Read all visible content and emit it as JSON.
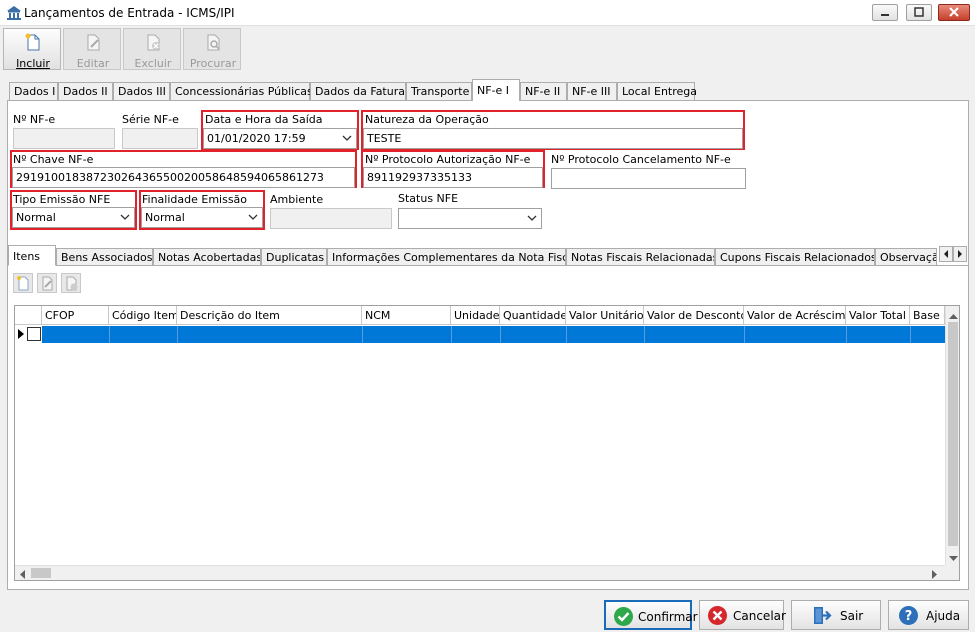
{
  "window": {
    "title": "Lançamentos de Entrada - ICMS/IPI",
    "icon": "bank-icon"
  },
  "toolbar": {
    "incluir": "Incluir",
    "editar": "Editar",
    "excluir": "Excluir",
    "procurar": "Procurar"
  },
  "main_tabs": [
    {
      "label": "Dados I"
    },
    {
      "label": "Dados II"
    },
    {
      "label": "Dados III"
    },
    {
      "label": "Concessionárias Públicas"
    },
    {
      "label": "Dados da Fatura"
    },
    {
      "label": "Transporte"
    },
    {
      "label": "NF-e I",
      "active": true
    },
    {
      "label": "NF-e II"
    },
    {
      "label": "NF-e III"
    },
    {
      "label": "Local Entrega"
    }
  ],
  "form": {
    "nf_numero": {
      "label": "Nº NF-e",
      "value": ""
    },
    "serie": {
      "label": "Série NF-e",
      "value": ""
    },
    "data_hora_saida": {
      "label": "Data e Hora da Saída",
      "value": "01/01/2020 17:59"
    },
    "natureza_operacao": {
      "label": "Natureza da Operação",
      "value": "TESTE"
    },
    "chave_nfe": {
      "label": "Nº Chave NF-e",
      "value": "29191001838723026436550020058648594065861273"
    },
    "protocolo_autorizacao": {
      "label": "Nº Protocolo Autorização NF-e",
      "value": "891192937335133"
    },
    "protocolo_cancelamento": {
      "label": "Nº Protocolo Cancelamento NF-e",
      "value": ""
    },
    "tipo_emissao": {
      "label": "Tipo Emissão NFE",
      "value": "Normal"
    },
    "finalidade_emissao": {
      "label": "Finalidade Emissão",
      "value": "Normal"
    },
    "ambiente": {
      "label": "Ambiente",
      "value": ""
    },
    "status_nfe": {
      "label": "Status NFE",
      "value": ""
    }
  },
  "inner_tabs": [
    {
      "label": "Itens",
      "active": true
    },
    {
      "label": "Bens Associados"
    },
    {
      "label": "Notas Acobertadas"
    },
    {
      "label": "Duplicatas"
    },
    {
      "label": "Informações Complementares da Nota Fiscal"
    },
    {
      "label": "Notas Fiscais Relacionadas"
    },
    {
      "label": "Cupons Fiscais Relacionados"
    },
    {
      "label": "Observaçã"
    }
  ],
  "grid": {
    "columns": [
      "CFOP",
      "Código Item",
      "Descrição do Item",
      "NCM",
      "Unidade",
      "Quantidade",
      "Valor Unitário",
      "Valor de Desconto",
      "Valor de Acréscimo",
      "Valor Total",
      "Base c"
    ]
  },
  "buttons": {
    "confirmar": "Confirmar",
    "cancelar": "Cancelar",
    "sair": "Sair",
    "ajuda": "Ajuda"
  },
  "colors": {
    "highlight": "#e1222b",
    "selection": "#0078d7",
    "confirm_border": "#1b6bb8"
  }
}
